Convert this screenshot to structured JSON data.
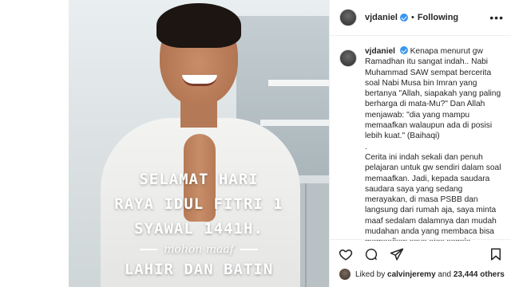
{
  "post": {
    "username": "vjdaniel",
    "follow_status": "Following",
    "separator": "•",
    "more_glyph": "•••",
    "verified_color": "#3897f0",
    "image_text": {
      "line1": "SELAMAT HARI",
      "line2": "RAYA IDUL FITRI 1",
      "line3": "SYAWAL 1441H.",
      "script": "mohon maaf",
      "line4": "LAHIR DAN BATIN"
    },
    "caption": {
      "username": "vjdaniel",
      "paragraph1": "Kenapa menurut gw Ramadhan itu sangat indah.. Nabi Muhammad SAW sempat bercerita soal Nabi Musa bin Imran yang bertanya \"Allah, siapakah yang paling berharga di mata-Mu?\" Dan Allah menjawab: \"dia yang mampu memaafkan walaupun ada di posisi lebih kuat.\" (Baihaqi)",
      "dot": ".",
      "paragraph2": "Cerita ini indah sekali dan penuh pelajaran untuk gw sendiri dalam soal memaafkan. Jadi, kepada saudara saudara saya yang sedang merayakan, di masa PSBB dan langsung dari rumah aja, saya minta maaf sedalam dalamnya dan mudah mudahan anda yang membaca bisa memaafkan saya atas segala kesalahan yang disengaja"
    },
    "actions": {
      "like_icon": "heart-icon",
      "comment_icon": "comment-icon",
      "share_icon": "share-icon",
      "save_icon": "bookmark-icon"
    },
    "likes": {
      "prefix": "Liked by",
      "user": "calvinjeremy",
      "middle": "and",
      "count": "23,444 others"
    }
  }
}
